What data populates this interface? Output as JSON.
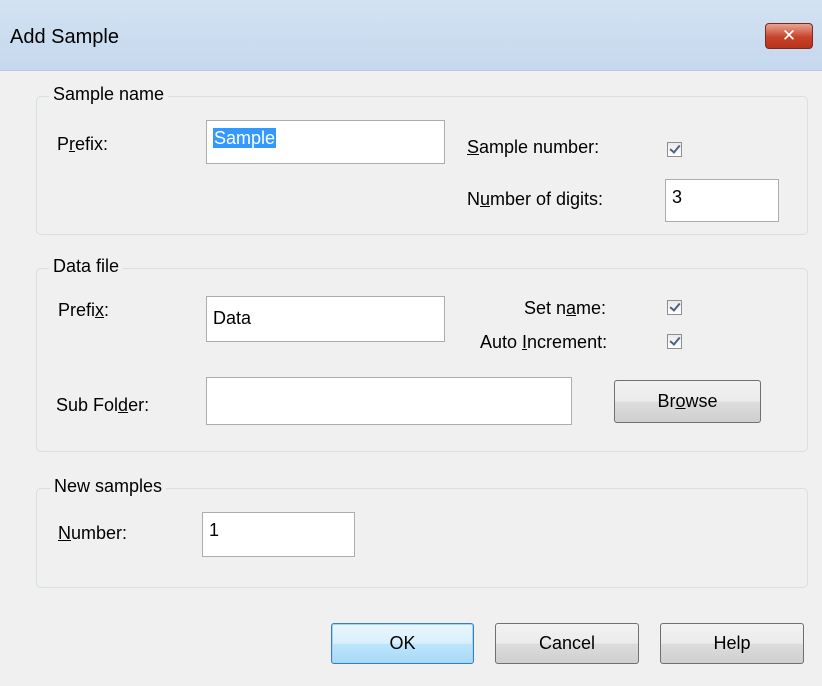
{
  "window": {
    "title": "Add Sample",
    "close_glyph": "✕"
  },
  "sample_name": {
    "legend": "Sample name",
    "prefix_label": [
      "P",
      "r",
      "efix:"
    ],
    "prefix_value": "Sample",
    "sample_number_label": [
      "",
      "S",
      "ample number:"
    ],
    "sample_number_checked": true,
    "digits_label": [
      "N",
      "u",
      "mber of digits:"
    ],
    "digits_value": "3"
  },
  "data_file": {
    "legend": "Data file",
    "prefix_label": [
      "Prefi",
      "x",
      ":"
    ],
    "prefix_value": "Data",
    "set_name_label": [
      "Set n",
      "a",
      "me:"
    ],
    "set_name_checked": true,
    "auto_increment_label": [
      "Auto ",
      "I",
      "ncrement:"
    ],
    "auto_increment_checked": true,
    "subfolder_label": [
      "Sub Fol",
      "d",
      "er:"
    ],
    "subfolder_value": "",
    "browse_label": [
      "Br",
      "o",
      "wse"
    ]
  },
  "new_samples": {
    "legend": "New samples",
    "number_label": [
      "",
      "N",
      "umber:"
    ],
    "number_value": "1"
  },
  "buttons": {
    "ok": "OK",
    "cancel": "Cancel",
    "help": "Help"
  }
}
